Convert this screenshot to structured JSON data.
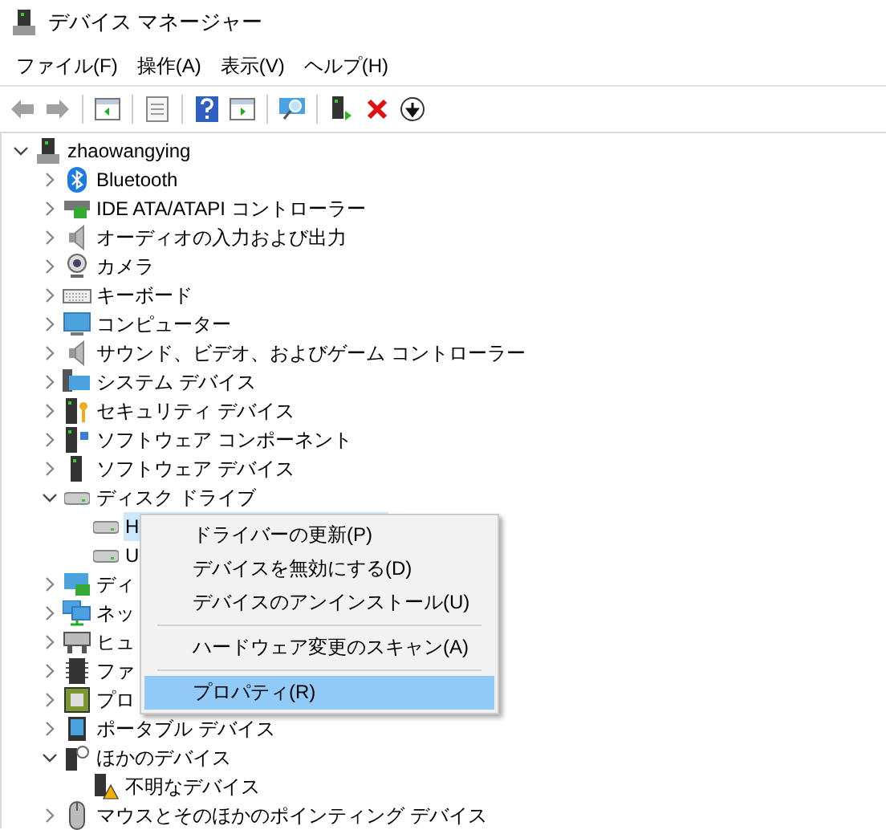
{
  "window": {
    "title": "デバイス マネージャー"
  },
  "menu_bar": [
    {
      "label": "ファイル(F)"
    },
    {
      "label": "操作(A)"
    },
    {
      "label": "表示(V)"
    },
    {
      "label": "ヘルプ(H)"
    }
  ],
  "toolbar": {
    "back_disabled": true,
    "forward_disabled": true
  },
  "tree": [
    {
      "label": "zhaowangying",
      "expanded": true,
      "selected": false,
      "children": [
        {
          "label": "Bluetooth",
          "expanded": false,
          "selected": false
        },
        {
          "label": "IDE ATA/ATAPI コントローラー",
          "expanded": false,
          "selected": false
        },
        {
          "label": "オーディオの入力および出力",
          "expanded": false,
          "selected": false
        },
        {
          "label": "カメラ",
          "expanded": false,
          "selected": false
        },
        {
          "label": "キーボード",
          "expanded": false,
          "selected": false
        },
        {
          "label": "コンピューター",
          "expanded": false,
          "selected": false
        },
        {
          "label": "サウンド、ビデオ、およびゲーム コントローラー",
          "expanded": false,
          "selected": false
        },
        {
          "label": "システム デバイス",
          "expanded": false,
          "selected": false
        },
        {
          "label": "セキュリティ デバイス",
          "expanded": false,
          "selected": false
        },
        {
          "label": "ソフトウェア コンポーネント",
          "expanded": false,
          "selected": false
        },
        {
          "label": "ソフトウェア デバイス",
          "expanded": false,
          "selected": false
        },
        {
          "label": "ディスク ドライブ",
          "expanded": true,
          "selected": false,
          "children": [
            {
              "label": "H",
              "selected": true
            },
            {
              "label": "U",
              "selected": false
            }
          ]
        },
        {
          "label": "ディ",
          "expanded": false,
          "selected": false
        },
        {
          "label": "ネッ",
          "expanded": false,
          "selected": false
        },
        {
          "label": "ヒュ",
          "expanded": false,
          "selected": false
        },
        {
          "label": "ファ",
          "expanded": false,
          "selected": false
        },
        {
          "label": "プロ",
          "expanded": false,
          "selected": false
        },
        {
          "label": "ポータブル デバイス",
          "expanded": false,
          "selected": false
        },
        {
          "label": "ほかのデバイス",
          "expanded": true,
          "selected": false,
          "children": [
            {
              "label": "不明なデバイス",
              "selected": false
            }
          ]
        },
        {
          "label": "マウスとそのほかのポインティング デバイス",
          "expanded": false,
          "selected": false
        }
      ]
    }
  ],
  "context_menu": [
    {
      "kind": "item",
      "label": "ドライバーの更新(P)",
      "selected": false
    },
    {
      "kind": "item",
      "label": "デバイスを無効にする(D)",
      "selected": false
    },
    {
      "kind": "item",
      "label": "デバイスのアンインストール(U)",
      "selected": false
    },
    {
      "kind": "separator"
    },
    {
      "kind": "item",
      "label": "ハードウェア変更のスキャン(A)",
      "selected": false
    },
    {
      "kind": "separator"
    },
    {
      "kind": "item",
      "label": "プロパティ(R)",
      "selected": true
    }
  ]
}
